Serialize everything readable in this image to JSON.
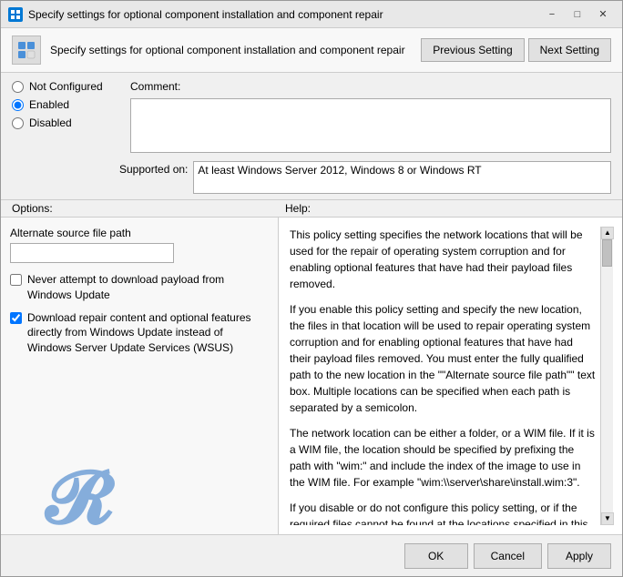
{
  "window": {
    "title": "Specify settings for optional component installation and component repair",
    "icon": "⚙"
  },
  "header": {
    "title": "Specify settings for optional component installation and component repair"
  },
  "nav": {
    "previous_label": "Previous Setting",
    "next_label": "Next Setting"
  },
  "radio": {
    "not_configured_label": "Not Configured",
    "enabled_label": "Enabled",
    "disabled_label": "Disabled",
    "selected": "enabled"
  },
  "comment": {
    "label": "Comment:",
    "value": ""
  },
  "supported": {
    "label": "Supported on:",
    "value": "At least Windows Server 2012, Windows 8 or Windows RT"
  },
  "sections": {
    "options_label": "Options:",
    "help_label": "Help:"
  },
  "options": {
    "alt_source_label": "Alternate source file path",
    "alt_source_value": "",
    "never_download_label": "Never attempt to download payload from Windows Update",
    "never_download_checked": false,
    "download_repair_label": "Download repair content and optional features directly from Windows Update instead of Windows Server Update Services (WSUS)",
    "download_repair_checked": true
  },
  "help": {
    "paragraphs": [
      "This policy setting specifies the network locations that will be used for the repair of operating system corruption and for enabling optional features that have had their payload files removed.",
      "If you enable this policy setting and specify the new location, the files in that location will be used to repair operating system corruption and for enabling optional features that have had their payload files removed. You must enter the fully qualified path to the new location in the \"\"Alternate source file path\"\" text box. Multiple locations can be specified when each path is separated by a semicolon.",
      "The network location can be either a folder, or a WIM file. If it is a WIM file, the location should be specified by prefixing the path with \"wim:\" and include the index of the image to use in the WIM file. For example \"wim:\\\\server\\share\\install.wim:3\".",
      "If you disable or do not configure this policy setting, or if the required files cannot be found at the locations specified in this"
    ]
  },
  "footer": {
    "ok_label": "OK",
    "cancel_label": "Cancel",
    "apply_label": "Apply"
  }
}
